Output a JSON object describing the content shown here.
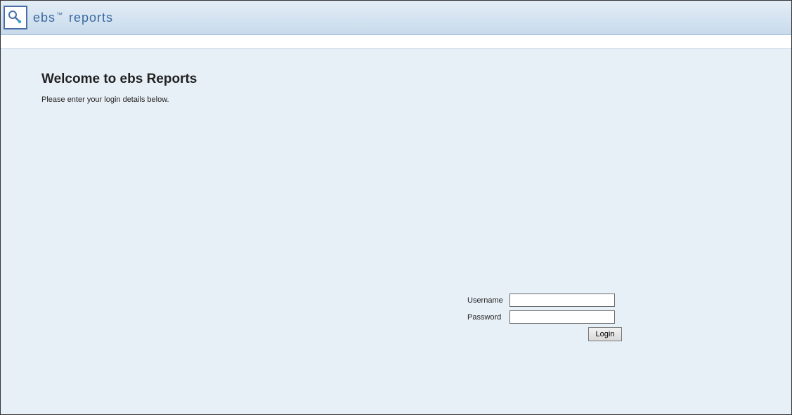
{
  "header": {
    "brand_prefix": "ebs",
    "brand_tm": "™",
    "brand_suffix": "reports"
  },
  "main": {
    "heading": "Welcome to ebs Reports",
    "instruction": "Please enter your login details below."
  },
  "form": {
    "username_label": "Username",
    "password_label": "Password",
    "username_value": "",
    "password_value": "",
    "login_button": "Login"
  }
}
